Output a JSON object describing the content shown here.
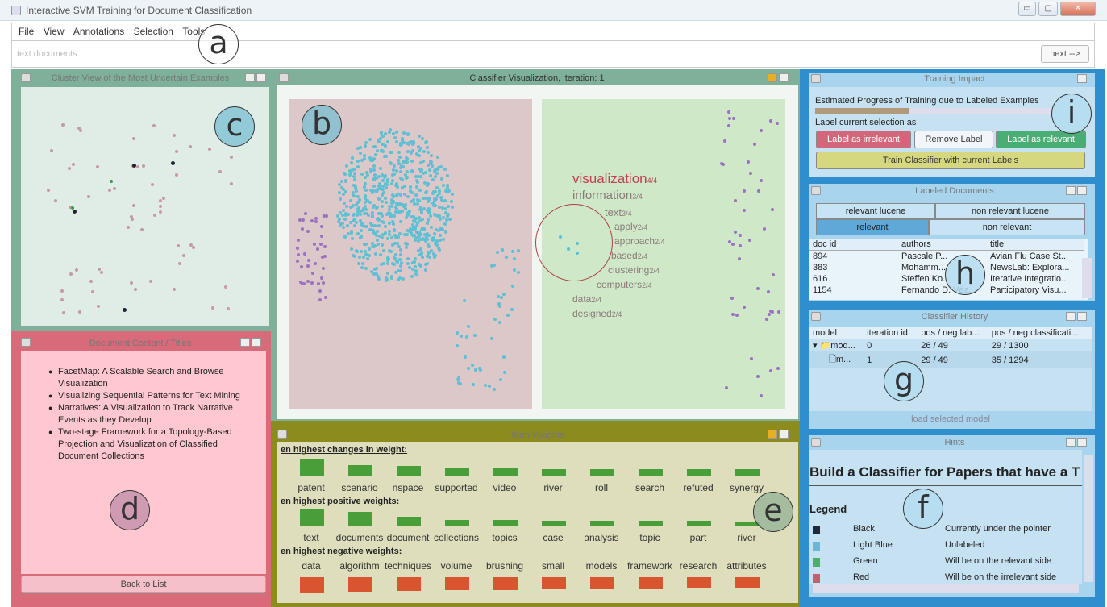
{
  "window": {
    "title": "Interactive SVM Training for Document Classification"
  },
  "menu": [
    "File",
    "View",
    "Annotations",
    "Selection",
    "Tools"
  ],
  "breadcrumb": {
    "text": "text documents",
    "next": "next -->"
  },
  "markers": {
    "a": "a",
    "b": "b",
    "c": "c",
    "d": "d",
    "e": "e",
    "f": "f",
    "g": "g",
    "h": "h",
    "i": "i"
  },
  "cluster": {
    "title": "Cluster View of the Most Uncertain Examples"
  },
  "classifier": {
    "title": "Classifier Visualization, iteration: 1",
    "terms": [
      {
        "w": "visualization",
        "c": "4/4"
      },
      {
        "w": "information",
        "c": "3/4"
      },
      {
        "w": "text",
        "c": "3/4"
      },
      {
        "w": "apply",
        "c": "2/4"
      },
      {
        "w": "approach",
        "c": "2/4"
      },
      {
        "w": "based",
        "c": "2/4"
      },
      {
        "w": "clustering",
        "c": "2/4"
      },
      {
        "w": "computers",
        "c": "2/4"
      },
      {
        "w": "data",
        "c": "2/4"
      },
      {
        "w": "designed",
        "c": "2/4"
      }
    ]
  },
  "docs": {
    "title": "Document Content / Titles",
    "items": [
      "FacetMap: A Scalable Search and Browse Visualization",
      "Visualizing Sequential Patterns for Text Mining",
      "Narratives: A Visualization to Track Narrative Events as they Develop",
      "Two-stage Framework for a Topology-Based Projection and Visualization of Classified Document Collections"
    ],
    "back": "Back to List"
  },
  "weights": {
    "title": "Term Weights",
    "changes_label": "en highest changes in weight:",
    "changes": [
      {
        "t": "patent",
        "v": 1.0
      },
      {
        "t": "scenario",
        "v": 0.65
      },
      {
        "t": "nspace",
        "v": 0.6
      },
      {
        "t": "supported",
        "v": 0.5
      },
      {
        "t": "video",
        "v": 0.45
      },
      {
        "t": "river",
        "v": 0.4
      },
      {
        "t": "roll",
        "v": 0.4
      },
      {
        "t": "search",
        "v": 0.4
      },
      {
        "t": "refuted",
        "v": 0.4
      },
      {
        "t": "synergy",
        "v": 0.4
      }
    ],
    "positive_label": "en highest positive weights:",
    "positive": [
      {
        "t": "text",
        "v": 1.0
      },
      {
        "t": "documents",
        "v": 0.85
      },
      {
        "t": "document",
        "v": 0.55
      },
      {
        "t": "collections",
        "v": 0.35
      },
      {
        "t": "topics",
        "v": 0.35
      },
      {
        "t": "case",
        "v": 0.3
      },
      {
        "t": "analysis",
        "v": 0.3
      },
      {
        "t": "topic",
        "v": 0.3
      },
      {
        "t": "part",
        "v": 0.3
      },
      {
        "t": "river",
        "v": 0.25
      }
    ],
    "negative_label": "en highest negative weights:",
    "negative": [
      {
        "t": "data",
        "v": 1.0
      },
      {
        "t": "algorithm",
        "v": 0.9
      },
      {
        "t": "techniques",
        "v": 0.85
      },
      {
        "t": "volume",
        "v": 0.8
      },
      {
        "t": "brushing",
        "v": 0.8
      },
      {
        "t": "small",
        "v": 0.75
      },
      {
        "t": "models",
        "v": 0.75
      },
      {
        "t": "framework",
        "v": 0.75
      },
      {
        "t": "research",
        "v": 0.7
      },
      {
        "t": "attributes",
        "v": 0.7
      }
    ]
  },
  "impact": {
    "title": "Training Impact",
    "progress_label": "Estimated Progress of Training due to Labeled Examples",
    "progress": 0.39,
    "label_sel": "Label current selection as",
    "irrelevant": "Label as irrelevant",
    "remove": "Remove Label",
    "relevant": "Label as relevant",
    "train": "Train Classifier with current Labels"
  },
  "labeled": {
    "title": "Labeled Documents",
    "tabs1": [
      "relevant lucene",
      "non relevant lucene"
    ],
    "tabs2": [
      "relevant",
      "non relevant"
    ],
    "cols": [
      "doc id",
      "authors",
      "title"
    ],
    "rows": [
      [
        "894",
        "Pascale P...",
        "Avian Flu Case St..."
      ],
      [
        "383",
        "Mohamm...",
        "NewsLab: Explora..."
      ],
      [
        "616",
        "Steffen Ko...",
        "Iterative Integratio..."
      ],
      [
        "1154",
        "Fernando D. Véa...",
        "Participatory Visu..."
      ]
    ]
  },
  "history": {
    "title": "Classifier History",
    "cols": [
      "model",
      "iteration id",
      "pos / neg lab...",
      "pos / neg classificati..."
    ],
    "rows": [
      [
        "mod...",
        "0",
        "26 / 49",
        "29 / 1300"
      ],
      [
        "m...",
        "1",
        "29 / 49",
        "35 / 1294"
      ]
    ],
    "load": "load selected model"
  },
  "hints": {
    "title": "Hints",
    "heading": "Build a Classifier for Papers that have a T",
    "legend": "Legend",
    "items": [
      {
        "name": "Black",
        "desc": "Currently under the pointer",
        "color": "#1e2a3a"
      },
      {
        "name": "Light Blue",
        "desc": "Unlabeled",
        "color": "#6ab6d8"
      },
      {
        "name": "Green",
        "desc": "Will be on the relevant side",
        "color": "#4caf68"
      },
      {
        "name": "Red",
        "desc": "Will be on the irrelevant side",
        "color": "#c06070"
      }
    ]
  },
  "colors": {
    "cluster": "#7fb09a",
    "docs": "#d96a7a",
    "weights": "#8b8b1e",
    "right": "#2f8fce",
    "green": "#4a9e3a",
    "red": "#d85530"
  }
}
